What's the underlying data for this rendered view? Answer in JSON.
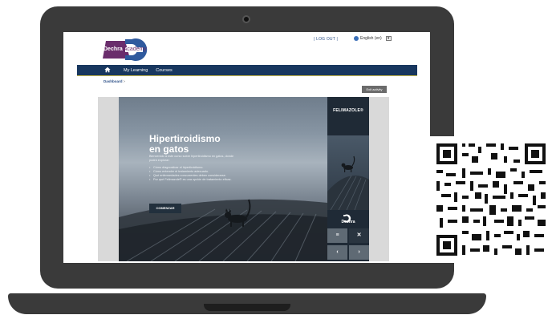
{
  "header": {
    "logo_text": "Dechra",
    "logo_text_academy": "Academy",
    "logout_label": "| LOG OUT |",
    "language_label": "English (en)"
  },
  "nav": {
    "items": [
      {
        "label": "My Learning"
      },
      {
        "label": "Courses"
      }
    ]
  },
  "breadcrumb": {
    "current": "Dashboard",
    "separator": ">"
  },
  "exit_button_label": "Exit activity",
  "course": {
    "title_line1": "Hipertiroidismo",
    "title_line2": "en gatos",
    "intro": "Bienvenido a este curso sobre hipertiroidismo en gatos, donde podrá explorar:",
    "bullets": [
      "Cómo diagnosticar el hipertiroidismo.",
      "Cómo entender el tratamiento adecuado.",
      "Qué enfermedades concurrentes deben considerarse.",
      "Por qué Felimazole® es una opción de tratamiento eficaz."
    ],
    "start_button": "COMENZAR",
    "brand": "FELIMAZOLE",
    "brand_mark": "®",
    "sidebar_company": "Dechra"
  },
  "colors": {
    "navbar": "#18375f",
    "accent_rule": "#c8b84a",
    "logo_purple": "#6a2d6c",
    "logo_blue": "#2f5a9e",
    "laptop": "#3a3a3a"
  },
  "icons": {
    "home": "home-icon",
    "menu": "menu-icon",
    "close": "close-icon",
    "prev": "chevron-left-icon",
    "next": "chevron-right-icon",
    "globe": "globe-icon"
  }
}
